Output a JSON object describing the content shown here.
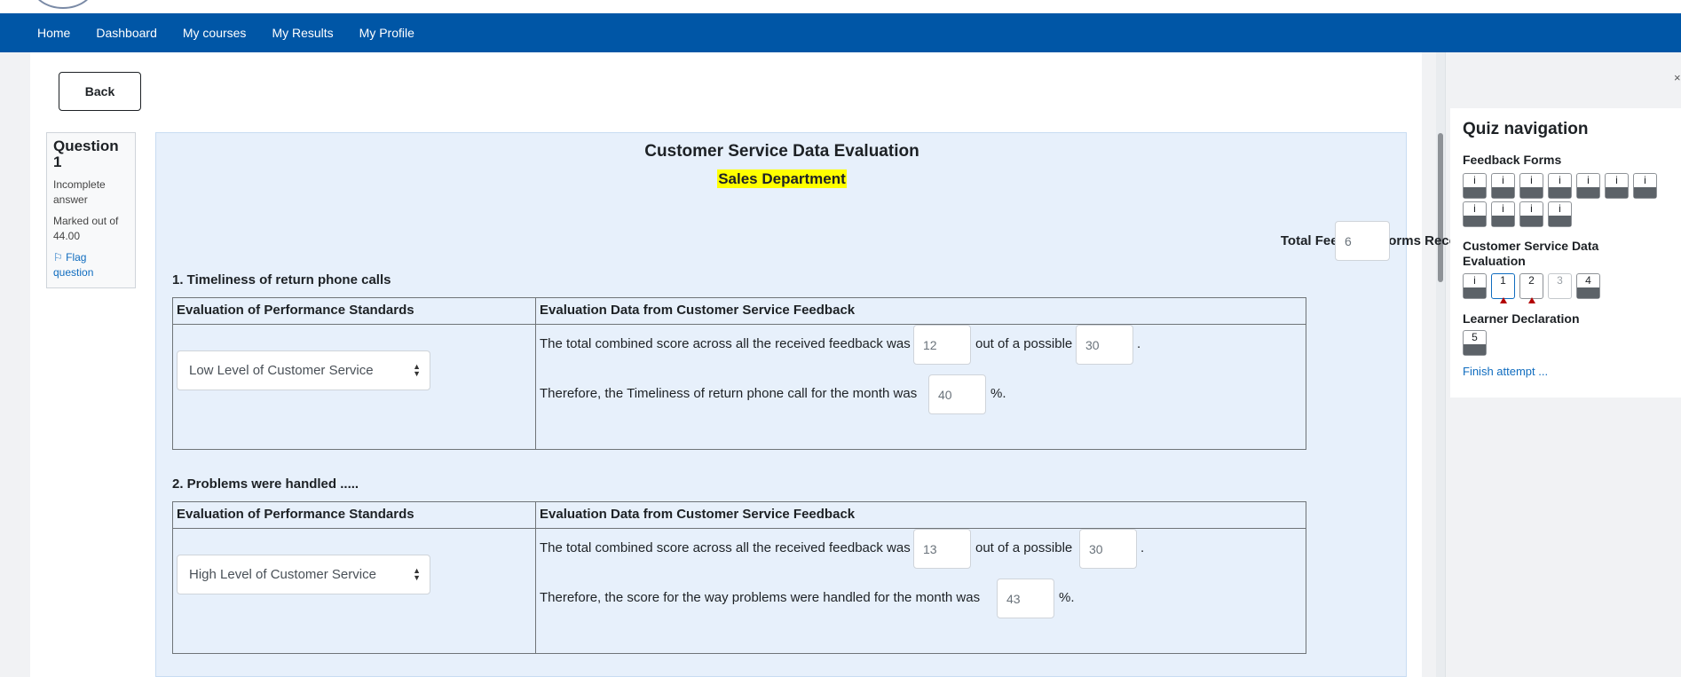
{
  "nav": {
    "items": [
      "Home",
      "Dashboard",
      "My courses",
      "My Results",
      "My Profile"
    ],
    "accent": "#0056a6"
  },
  "back_label": "Back",
  "question_info": {
    "label": "Question 1",
    "state": "Incomplete answer",
    "grade": "Marked out of 44.00",
    "flag": "Flag question"
  },
  "content": {
    "title": "Customer Service Data Evaluation",
    "subtitle": "Sales Department",
    "total_label": "Total Feedback Forms Received:",
    "total_value": "6",
    "col_left": "Evaluation of Performance Standards",
    "col_right": "Evaluation Data from Customer Service Feedback",
    "sections": [
      {
        "title": "1.  Timeliness of return phone calls",
        "select": "Low Level of Customer Service",
        "line1_a": "The total combined score across all the received feedback was",
        "score": "12",
        "line1_b": "out of a possible",
        "possible": "30",
        "line1_c": ".",
        "line2_a": "Therefore, the Timeliness of return phone call for the month was",
        "percent": "40",
        "line2_b": "%."
      },
      {
        "title": "2.  Problems were handled .....",
        "select": "High Level of Customer Service",
        "line1_a": "The total combined score across all the received feedback was",
        "score": "13",
        "line1_b": "out of a possible",
        "possible": "30",
        "line1_c": ".",
        "line2_a": "Therefore, the score for the way problems were handled for the month was",
        "percent": "43",
        "line2_b": "%."
      }
    ]
  },
  "quiz_nav": {
    "title": "Quiz navigation",
    "sections": [
      {
        "name": "Feedback Forms",
        "buttons": [
          "i",
          "i",
          "i",
          "i",
          "i",
          "i",
          "i",
          "i",
          "i",
          "i",
          "i"
        ]
      },
      {
        "name": "Customer Service Data Evaluation",
        "buttons": [
          "i",
          "1",
          "2",
          "3",
          "4"
        ]
      },
      {
        "name": "Learner Declaration",
        "buttons": [
          "5"
        ]
      }
    ],
    "finish": "Finish attempt ..."
  },
  "colors": {
    "highlight": "#ffff00",
    "flag": "#b30000",
    "link": "#0f6cbf"
  }
}
